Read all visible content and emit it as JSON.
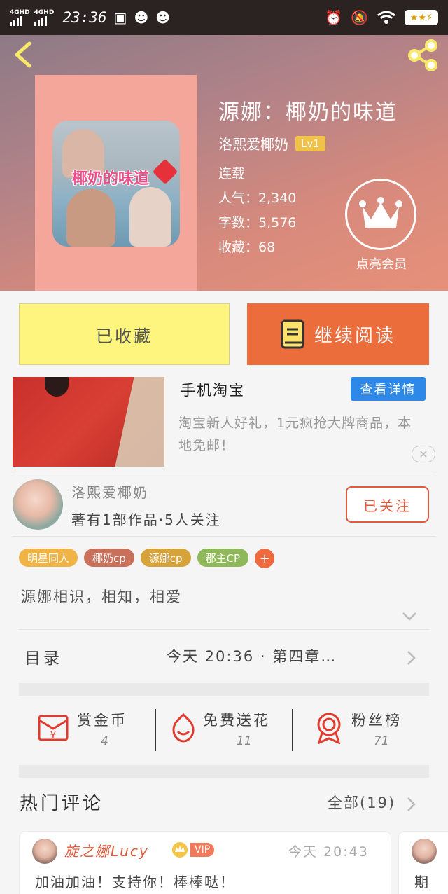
{
  "status_bar": {
    "network1": "4GHD",
    "network2": "4GHD",
    "time": "23:36"
  },
  "book": {
    "title": "源娜：椰奶的味道",
    "author": "洛熙爱椰奶",
    "level": "Lv1",
    "status": "连载",
    "popularity": "人气：2,340",
    "word_count": "字数：5,576",
    "favorites": "收藏：68",
    "cover_text": "椰奶的味道",
    "vip_label": "点亮会员"
  },
  "actions": {
    "collected_label": "已收藏",
    "read_label": "继续阅读"
  },
  "ad": {
    "title": "手机淘宝",
    "detail_button": "查看详情",
    "description": "淘宝新人好礼，1元疯抢大牌商品，本地免邮！",
    "close_symbol": "✕"
  },
  "author_card": {
    "name": "洛熙爱椰奶",
    "stats": "著有1部作品·5人关注",
    "follow_label": "已关注"
  },
  "tags": [
    {
      "label": "明星同人",
      "color": "#f0b446"
    },
    {
      "label": "椰奶cp",
      "color": "#c9705a"
    },
    {
      "label": "源娜cp",
      "color": "#d6a23a"
    },
    {
      "label": "郡主CP",
      "color": "#8fb85a"
    }
  ],
  "tag_add_symbol": "+",
  "intro": "源娜相识，相知，相爱",
  "toc": {
    "label": "目录",
    "latest": "今天 20:36 · 第四章…"
  },
  "stats": [
    {
      "label": "赏金币",
      "value": "4",
      "icon": "red-envelope-icon"
    },
    {
      "label": "免费送花",
      "value": "11",
      "icon": "flower-icon"
    },
    {
      "label": "粉丝榜",
      "value": "71",
      "icon": "medal-icon"
    }
  ],
  "hot_comments": {
    "title": "热门评论",
    "all_label": "全部(19)"
  },
  "comments": [
    {
      "user": "旋之娜Lucy",
      "vip": "VIP",
      "time": "今天 20:43",
      "text": "加油加油！支持你！棒棒哒！"
    },
    {
      "text": "期"
    }
  ],
  "colors": {
    "accent_orange": "#ec6d3c",
    "collected_yellow": "#fdf57d",
    "detail_blue": "#2d88e8"
  }
}
